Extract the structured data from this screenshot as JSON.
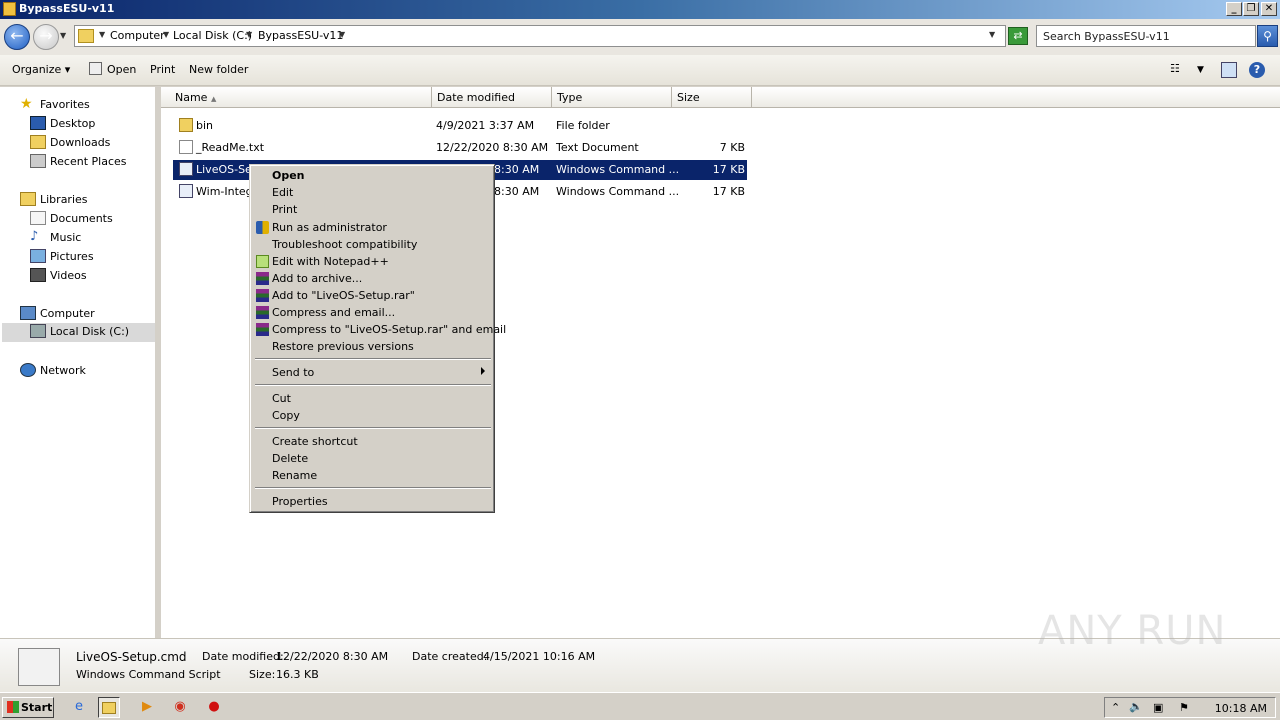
{
  "window": {
    "title": "BypassESU-v11"
  },
  "address": {
    "crumbs": [
      "Computer",
      "Local Disk (C:)",
      "BypassESU-v11"
    ],
    "search_placeholder": "Search BypassESU-v11"
  },
  "toolbar": {
    "organize": "Organize",
    "open": "Open",
    "print": "Print",
    "new_folder": "New folder"
  },
  "nav": {
    "favorites": "Favorites",
    "desktop": "Desktop",
    "downloads": "Downloads",
    "recent": "Recent Places",
    "libraries": "Libraries",
    "documents": "Documents",
    "music": "Music",
    "pictures": "Pictures",
    "videos": "Videos",
    "computer": "Computer",
    "local_disk": "Local Disk (C:)",
    "network": "Network"
  },
  "columns": {
    "name": "Name",
    "date": "Date modified",
    "type": "Type",
    "size": "Size"
  },
  "files": [
    {
      "name": "bin",
      "date": "4/9/2021 3:37 AM",
      "type": "File folder",
      "size": ""
    },
    {
      "name": "_ReadMe.txt",
      "date": "12/22/2020 8:30 AM",
      "type": "Text Document",
      "size": "7 KB"
    },
    {
      "name": "LiveOS-Setup.cmd",
      "date": "12/22/2020 8:30 AM",
      "type": "Windows Command ...",
      "size": "17 KB"
    },
    {
      "name": "Wim-Integration.cmd",
      "date": "12/22/2020 8:30 AM",
      "type": "Windows Command ...",
      "size": "17 KB"
    }
  ],
  "visible_names": [
    "bin",
    "_ReadMe.txt",
    "LiveOS-Setu",
    "Wim-Integr"
  ],
  "visible_dates": [
    "4/9/2021 3:37 AM",
    "12/22/2020 8:30 AM",
    "8:30 AM",
    "8:30 AM"
  ],
  "menu": {
    "open": "Open",
    "edit": "Edit",
    "print": "Print",
    "run_admin": "Run as administrator",
    "troubleshoot": "Troubleshoot compatibility",
    "notepadpp": "Edit with Notepad++",
    "add_archive": "Add to archive...",
    "add_rar": "Add to \"LiveOS-Setup.rar\"",
    "compress_email": "Compress and email...",
    "compress_rar_email": "Compress to \"LiveOS-Setup.rar\" and email",
    "restore": "Restore previous versions",
    "send_to": "Send to",
    "cut": "Cut",
    "copy": "Copy",
    "create_shortcut": "Create shortcut",
    "delete": "Delete",
    "rename": "Rename",
    "properties": "Properties"
  },
  "details": {
    "filename": "LiveOS-Setup.cmd",
    "filetype": "Windows Command Script",
    "date_modified_label": "Date modified:",
    "date_modified": "12/22/2020 8:30 AM",
    "size_label": "Size:",
    "size": "16.3 KB",
    "date_created_label": "Date created:",
    "date_created": "4/15/2021 10:16 AM"
  },
  "taskbar": {
    "start": "Start",
    "clock": "10:18 AM"
  },
  "watermark": "ANY RUN",
  "colors": {
    "selection": "#0a246a",
    "titlebar": "#0a246a"
  }
}
